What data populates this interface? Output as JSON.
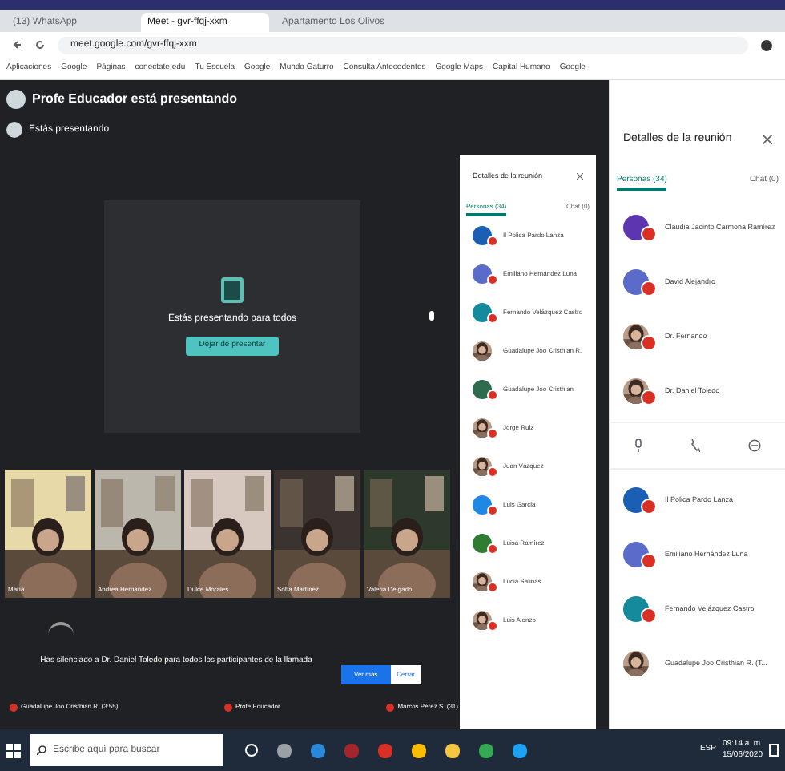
{
  "browser": {
    "tabs": [
      {
        "title": "(13) WhatsApp",
        "selected": false
      },
      {
        "title": "Meet - gvr-ffqj-xxm",
        "selected": true
      },
      {
        "title": "Apartamento Los Olivos",
        "selected": false
      }
    ],
    "address": "meet.google.com/gvr-ffqj-xxm",
    "bookmarks": [
      "Aplicaciones",
      "Google",
      "Páginas",
      "conectate.edu",
      "Tu Escuela",
      "Google",
      "Mundo Gaturro",
      "Consulta Antecedentes",
      "Google Maps",
      "Capital Humano",
      "Google"
    ]
  },
  "meet": {
    "presenter_banner": "Profe Educador está presentando",
    "self_banner": "Estás presentando",
    "card_title": "Estás presentando para todos",
    "card_button": "Dejar de presentar",
    "tiles": [
      {
        "name": "María"
      },
      {
        "name": "Andrea Hernández"
      },
      {
        "name": "Dulce Morales"
      },
      {
        "name": "Sofía Martínez"
      },
      {
        "name": "Valeria Delgado"
      }
    ],
    "notification": "Has silenciado a Dr. Daniel Toledo para todos los participantes de la llamada",
    "notification_buttons": [
      "Ver más",
      "Cerrar"
    ],
    "name_labels": [
      "Guadalupe Joo Cristhian R. (3:55)",
      "Profe Educador",
      "Marcos Pérez S. (31)"
    ]
  },
  "inner_panel": {
    "title": "Detalles de la reunión",
    "tabs": [
      {
        "label": "Personas (34)",
        "selected": true
      },
      {
        "label": "Chat (0)",
        "selected": false
      }
    ],
    "people": [
      {
        "name": "Il Polica Pardo Lanza",
        "kind": "letter",
        "color": "#1a5fb4",
        "muted": true
      },
      {
        "name": "Emiliano Hernández Luna",
        "kind": "letter",
        "color": "#5b6bc9",
        "muted": true
      },
      {
        "name": "Fernando Velázquez Castro",
        "kind": "letter",
        "color": "#148a9c",
        "muted": true
      },
      {
        "name": "Guadalupe Joo Cristhian R.",
        "muted": false
      },
      {
        "name": "Guadalupe Joo Cristhian",
        "kind": "letter",
        "color": "#2e6b4f",
        "muted": true
      },
      {
        "name": "Jorge Ruiz",
        "muted": true
      },
      {
        "name": "Juan Vázquez",
        "muted": true
      },
      {
        "name": "Luis Garcia",
        "kind": "letter",
        "color": "#1e88e5",
        "muted": true
      },
      {
        "name": "Luisa Ramírez",
        "kind": "letter",
        "color": "#2e7d32",
        "muted": true
      },
      {
        "name": "Lucia Salinas",
        "muted": true
      },
      {
        "name": "Luis Alonzo",
        "muted": true
      }
    ]
  },
  "side_panel": {
    "title": "Detalles de la reunión",
    "tabs": [
      {
        "label": "Personas (34)",
        "selected": true
      },
      {
        "label": "Chat (0)",
        "selected": false
      }
    ],
    "people": [
      {
        "name": "Claudia Jacinto Carmona Ramírez",
        "kind": "letter",
        "color": "#5e35b1",
        "muted": true
      },
      {
        "name": "David Alejandro",
        "kind": "letter",
        "color": "#5b6bc9",
        "muted": true
      },
      {
        "name": "Dr. Fernando",
        "muted": true
      },
      {
        "name": "Dr. Daniel Toledo",
        "muted": true
      },
      {
        "kind": "actions"
      },
      {
        "name": "Il Polica Pardo Lanza",
        "kind": "letter",
        "color": "#1a5fb4",
        "muted": true
      },
      {
        "name": "Emiliano Hernández Luna",
        "kind": "letter",
        "color": "#5b6bc9",
        "muted": true
      },
      {
        "name": "Fernando Velázquez Castro",
        "kind": "letter",
        "color": "#148a9c",
        "muted": true
      },
      {
        "name": "Guadalupe Joo Cristhian R. (T...",
        "muted": false
      }
    ]
  },
  "taskbar": {
    "search_placeholder": "Escribe aquí para buscar",
    "language": "ESP",
    "time": "09:14 a. m.",
    "date": "15/06/2020"
  }
}
